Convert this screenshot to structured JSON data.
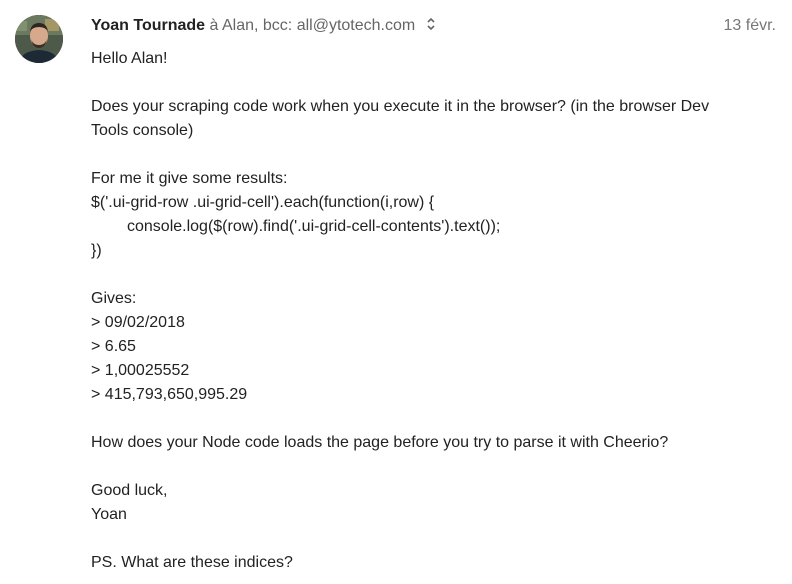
{
  "email": {
    "sender": {
      "name": "Yoan Tournade",
      "avatar_icon": "person-avatar-icon"
    },
    "recipients_text": "à Alan, bcc: all@ytotech.com",
    "expand_icon": "chevron-updown-icon",
    "date": "13 févr.",
    "body": {
      "greeting": "Hello Alan!",
      "question_line1": "Does your scraping code work when you execute it in the browser? (in the browser Dev",
      "question_line2": "Tools console)",
      "results_intro": "For me it give some results:",
      "code_line1": "$('.ui-grid-row .ui-grid-cell').each(function(i,row) {",
      "code_line2": "console.log($(row).find('.ui-grid-cell-contents').text());",
      "code_line3": "})",
      "gives": "Gives:",
      "outputs": [
        "> 09/02/2018",
        "> 6.65",
        "> 1,00025552",
        "> 415,793,650,995.29"
      ],
      "node_question": "How does your Node code loads the page before you try to parse it with Cheerio?",
      "closing": "Good luck,",
      "signature": "Yoan",
      "ps": "PS. What are these indices?"
    }
  }
}
